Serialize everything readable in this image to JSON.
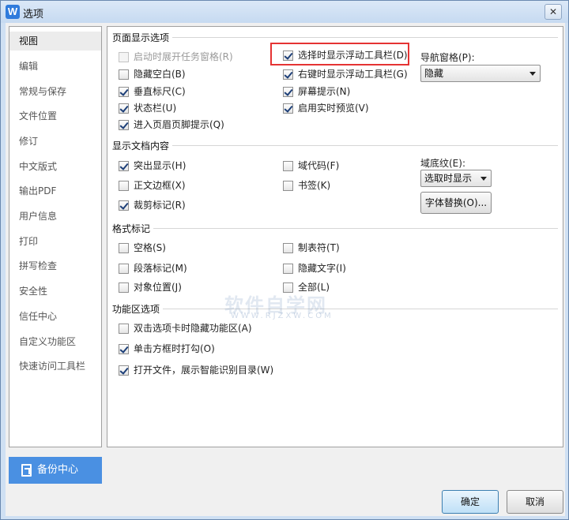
{
  "window": {
    "title": "选项",
    "app_icon_letter": "W",
    "close_symbol": "✕"
  },
  "sidebar": {
    "items": [
      {
        "label": "视图",
        "active": true
      },
      {
        "label": "编辑"
      },
      {
        "label": "常规与保存"
      },
      {
        "label": "文件位置"
      },
      {
        "label": "修订"
      },
      {
        "label": "中文版式"
      },
      {
        "label": "输出PDF"
      },
      {
        "label": "用户信息"
      },
      {
        "label": "打印"
      },
      {
        "label": "拼写检查"
      },
      {
        "label": "安全性"
      },
      {
        "label": "信任中心"
      },
      {
        "label": "自定义功能区"
      },
      {
        "label": "快速访问工具栏"
      }
    ],
    "backup_label": "备份中心"
  },
  "page_display": {
    "title": "页面显示选项",
    "options": [
      {
        "label": "启动时展开任务窗格(R)",
        "checked": false,
        "disabled": true
      },
      {
        "label": "隐藏空白(B)",
        "checked": false
      },
      {
        "label": "垂直标尺(C)",
        "checked": true
      },
      {
        "label": "状态栏(U)",
        "checked": true
      },
      {
        "label": "进入页眉页脚提示(Q)",
        "checked": true
      },
      {
        "label": "选择时显示浮动工具栏(D)",
        "checked": true
      },
      {
        "label": "右键时显示浮动工具栏(G)",
        "checked": true
      },
      {
        "label": "屏幕提示(N)",
        "checked": true
      },
      {
        "label": "启用实时预览(V)",
        "checked": true
      }
    ],
    "nav_pane_label": "导航窗格(P):",
    "nav_pane_value": "隐藏"
  },
  "doc_content": {
    "title": "显示文档内容",
    "options": [
      {
        "label": "突出显示(H)",
        "checked": true
      },
      {
        "label": "正文边框(X)",
        "checked": false
      },
      {
        "label": "裁剪标记(R)",
        "checked": true
      },
      {
        "label": "域代码(F)",
        "checked": false
      },
      {
        "label": "书签(K)",
        "checked": false
      }
    ],
    "shading_label": "域底纹(E):",
    "shading_value": "选取时显示",
    "font_sub_button": "字体替换(O)..."
  },
  "format_marks": {
    "title": "格式标记",
    "options": [
      {
        "label": "空格(S)",
        "checked": false
      },
      {
        "label": "段落标记(M)",
        "checked": false
      },
      {
        "label": "对象位置(J)",
        "checked": false
      },
      {
        "label": "制表符(T)",
        "checked": false
      },
      {
        "label": "隐藏文字(I)",
        "checked": false
      },
      {
        "label": "全部(L)",
        "checked": false
      }
    ]
  },
  "ribbon": {
    "title": "功能区选项",
    "options": [
      {
        "label": "双击选项卡时隐藏功能区(A)",
        "checked": false
      },
      {
        "label": "单击方框时打勾(O)",
        "checked": true
      },
      {
        "label": "打开文件，展示智能识别目录(W)",
        "checked": true
      }
    ]
  },
  "watermark": {
    "text": "软件自学网",
    "sub": "WWW.RJZXW.COM"
  },
  "footer": {
    "ok_label": "确定",
    "cancel_label": "取消"
  }
}
